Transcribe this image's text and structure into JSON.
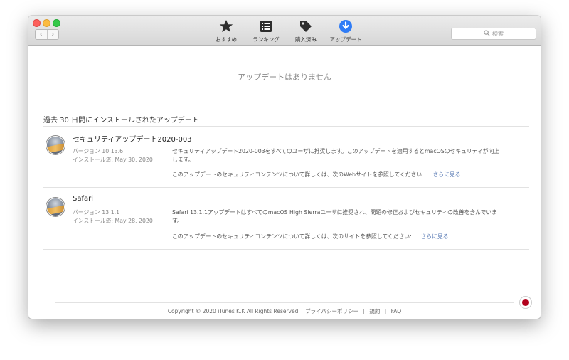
{
  "toolbar": {
    "back_glyph": "‹",
    "forward_glyph": "›",
    "tabs": [
      {
        "label": "おすすめ",
        "icon": "star-icon"
      },
      {
        "label": "ランキング",
        "icon": "list-icon"
      },
      {
        "label": "購入済み",
        "icon": "tag-icon"
      },
      {
        "label": "アップデート",
        "icon": "download-icon",
        "active": true
      }
    ],
    "search_placeholder": "検索"
  },
  "main": {
    "empty_message": "アップデートはありません",
    "section_title": "過去 30 日間にインストールされたアップデート",
    "updates": [
      {
        "title": "セキュリティアップデート2020-003",
        "version": "バージョン 10.13.6",
        "installed": "インストール済: May 30, 2020",
        "description": "セキュリティアップデート2020-003をすべてのユーザに推奨します。このアップデートを適用するとmacOSのセキュリティが向上します。",
        "more_text": "このアップデートのセキュリティコンテンツについて詳しくは、次のWebサイトを参照してください: …",
        "more_link": "さらに見る"
      },
      {
        "title": "Safari",
        "version": "バージョン 13.1.1",
        "installed": "インストール済: May 28, 2020",
        "description": "Safari 13.1.1アップデートはすべてのmacOS High Sierraユーザに推奨され、問題の修正およびセキュリティの改善を含んでいます。",
        "more_text": "このアップデートのセキュリティコンテンツについて詳しくは、次のサイトを参照してください: …",
        "more_link": "さらに見る"
      }
    ]
  },
  "footer": {
    "copyright": "Copyright © 2020 iTunes K.K All Rights Reserved.",
    "privacy": "プライバシーポリシー",
    "separator": "|",
    "terms": "規約",
    "faq": "FAQ"
  },
  "colors": {
    "accent": "#2f7cf6",
    "link": "#5a7bb5",
    "flag": "#b2001c"
  }
}
